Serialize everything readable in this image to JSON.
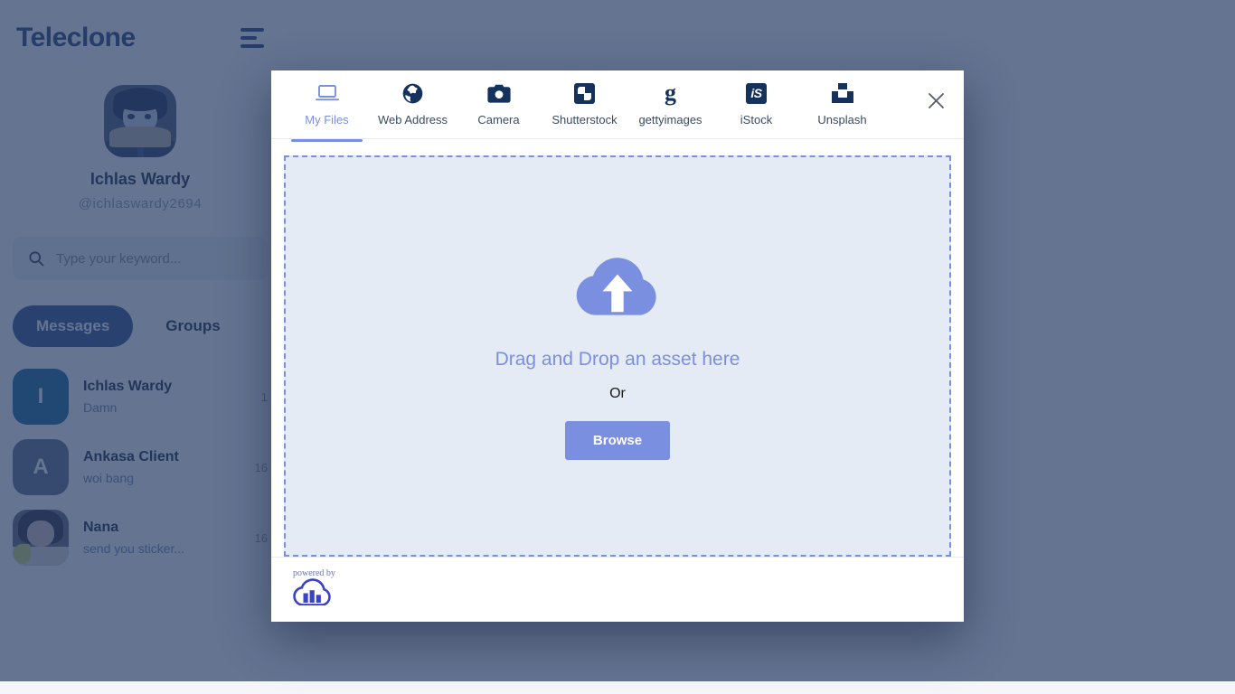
{
  "app": {
    "brand": "Teleclone",
    "menu_icon": "hamburger-icon",
    "profile": {
      "name": "Ichlas Wardy",
      "handle": "@ichlaswardy2694",
      "avatar_icon": "user-avatar"
    },
    "search": {
      "placeholder": "Type your keyword...",
      "value": "",
      "icon": "search-icon"
    },
    "list_tabs": [
      {
        "label": "Messages",
        "active": true
      },
      {
        "label": "Groups",
        "active": false
      }
    ],
    "chats": [
      {
        "initial": "I",
        "name": "Ichlas Wardy",
        "preview": "Damn",
        "time": "1",
        "avatar_color": "#0f5e94",
        "kind": "initial"
      },
      {
        "initial": "A",
        "name": "Ankasa Client",
        "preview": "woi bang",
        "time": "16",
        "avatar_color": "#5a6a86",
        "kind": "initial"
      },
      {
        "initial": "",
        "name": "Nana",
        "preview": "send you sticker...",
        "time": "16",
        "avatar_color": "#5a5f70",
        "kind": "photo"
      }
    ]
  },
  "modal": {
    "close_icon": "close-icon",
    "tabs": [
      {
        "label": "My Files",
        "icon": "laptop-icon",
        "active": true
      },
      {
        "label": "Web Address",
        "icon": "globe-icon",
        "active": false
      },
      {
        "label": "Camera",
        "icon": "camera-icon",
        "active": false
      },
      {
        "label": "Shutterstock",
        "icon": "shutterstock-icon",
        "active": false
      },
      {
        "label": "gettyimages",
        "icon": "gettyimages-icon",
        "active": false
      },
      {
        "label": "iStock",
        "icon": "istock-icon",
        "active": false
      },
      {
        "label": "Unsplash",
        "icon": "unsplash-icon",
        "active": false
      }
    ],
    "dropzone": {
      "cloud_icon": "cloud-upload-icon",
      "title": "Drag and Drop an asset here",
      "or": "Or",
      "browse_label": "Browse"
    },
    "footer": {
      "powered_by": "powered by",
      "logo_icon": "filestack-cloud-logo"
    }
  },
  "colors": {
    "accent": "#7b8fe0",
    "brand_dark": "#1d3a6b",
    "tab_icon": "#14325c",
    "dropzone_bg": "#e5ebf4",
    "overlay": "rgba(40,62,102,0.72)"
  }
}
